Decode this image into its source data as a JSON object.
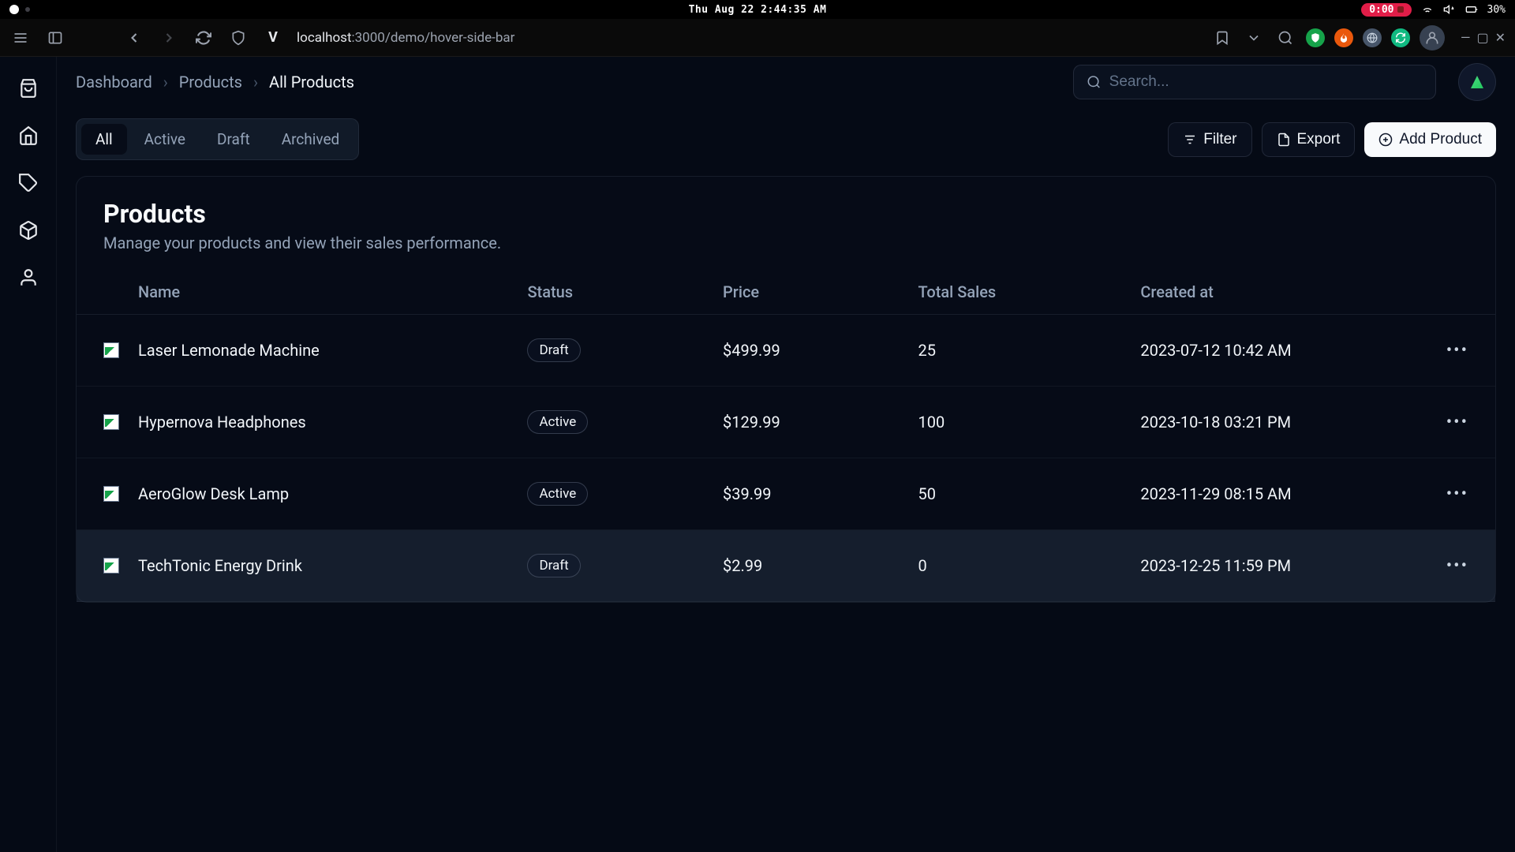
{
  "os": {
    "clock": "Thu Aug 22  2:44:35 AM",
    "recording": "0:00",
    "battery": "30%"
  },
  "browser": {
    "url_host": "localhost",
    "url_port_path": ":3000/demo/hover-side-bar"
  },
  "breadcrumbs": [
    "Dashboard",
    "Products",
    "All Products"
  ],
  "search": {
    "placeholder": "Search..."
  },
  "tabs": [
    "All",
    "Active",
    "Draft",
    "Archived"
  ],
  "active_tab": "All",
  "buttons": {
    "filter": "Filter",
    "export": "Export",
    "add": "Add Product"
  },
  "card": {
    "title": "Products",
    "subtitle": "Manage your products and view their sales performance."
  },
  "columns": {
    "name": "Name",
    "status": "Status",
    "price": "Price",
    "sales": "Total Sales",
    "created": "Created at"
  },
  "rows": [
    {
      "name": "Laser Lemonade Machine",
      "status": "Draft",
      "price": "$499.99",
      "sales": "25",
      "created": "2023-07-12 10:42 AM",
      "hovered": false
    },
    {
      "name": "Hypernova Headphones",
      "status": "Active",
      "price": "$129.99",
      "sales": "100",
      "created": "2023-10-18 03:21 PM",
      "hovered": false
    },
    {
      "name": "AeroGlow Desk Lamp",
      "status": "Active",
      "price": "$39.99",
      "sales": "50",
      "created": "2023-11-29 08:15 AM",
      "hovered": false
    },
    {
      "name": "TechTonic Energy Drink",
      "status": "Draft",
      "price": "$2.99",
      "sales": "0",
      "created": "2023-12-25 11:59 PM",
      "hovered": true
    }
  ]
}
